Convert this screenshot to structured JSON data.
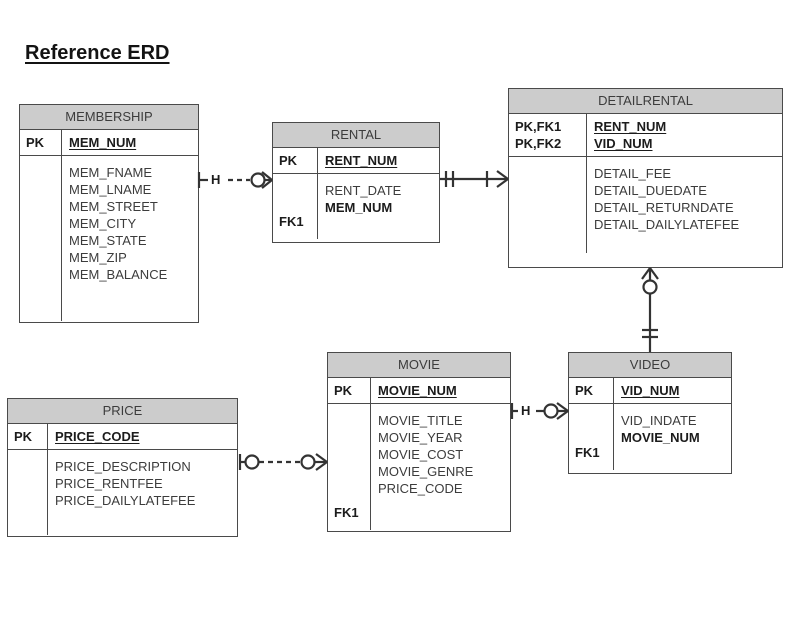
{
  "page": {
    "title": "Reference ERD",
    "background": "#ffffff",
    "line_color": "#333333",
    "header_fill": "#cccccc",
    "border_color": "#4a4a4a"
  },
  "entities": [
    {
      "name": "MEMBERSHIP",
      "keys": [
        "PK"
      ],
      "key_attributes": [
        "MEM_NUM"
      ],
      "attributes": [
        {
          "key": "",
          "name": "MEM_FNAME"
        },
        {
          "key": "",
          "name": "MEM_LNAME"
        },
        {
          "key": "",
          "name": "MEM_STREET"
        },
        {
          "key": "",
          "name": "MEM_CITY"
        },
        {
          "key": "",
          "name": "MEM_STATE"
        },
        {
          "key": "",
          "name": "MEM_ZIP"
        },
        {
          "key": "",
          "name": "MEM_BALANCE"
        }
      ]
    },
    {
      "name": "RENTAL",
      "keys": [
        "PK"
      ],
      "key_attributes": [
        "RENT_NUM"
      ],
      "attributes": [
        {
          "key": "",
          "name": "RENT_DATE"
        },
        {
          "key": "FK1",
          "name": "MEM_NUM",
          "bold": true
        }
      ]
    },
    {
      "name": "DETAILRENTAL",
      "keys": [
        "PK,FK1",
        "PK,FK2"
      ],
      "key_attributes": [
        "RENT_NUM",
        "VID_NUM"
      ],
      "attributes": [
        {
          "key": "",
          "name": "DETAIL_FEE"
        },
        {
          "key": "",
          "name": "DETAIL_DUEDATE"
        },
        {
          "key": "",
          "name": "DETAIL_RETURNDATE"
        },
        {
          "key": "",
          "name": "DETAIL_DAILYLATEFEE"
        }
      ]
    },
    {
      "name": "PRICE",
      "keys": [
        "PK"
      ],
      "key_attributes": [
        "PRICE_CODE"
      ],
      "attributes": [
        {
          "key": "",
          "name": "PRICE_DESCRIPTION"
        },
        {
          "key": "",
          "name": "PRICE_RENTFEE"
        },
        {
          "key": "",
          "name": "PRICE_DAILYLATEFEE"
        }
      ]
    },
    {
      "name": "MOVIE",
      "keys": [
        "PK"
      ],
      "key_attributes": [
        "MOVIE_NUM"
      ],
      "attributes": [
        {
          "key": "",
          "name": "MOVIE_TITLE"
        },
        {
          "key": "",
          "name": "MOVIE_YEAR"
        },
        {
          "key": "",
          "name": "MOVIE_COST"
        },
        {
          "key": "",
          "name": "MOVIE_GENRE"
        },
        {
          "key": "FK1",
          "name": "PRICE_CODE"
        }
      ]
    },
    {
      "name": "VIDEO",
      "keys": [
        "PK"
      ],
      "key_attributes": [
        "VID_NUM"
      ],
      "attributes": [
        {
          "key": "",
          "name": "VID_INDATE"
        },
        {
          "key": "FK1",
          "name": "MOVIE_NUM",
          "bold": true
        }
      ]
    }
  ],
  "relationships": [
    {
      "from": "MEMBERSHIP",
      "to": "RENTAL",
      "line_style": "dashed",
      "from_cardinality": "one-mandatory",
      "to_cardinality": "zero-or-many",
      "label": "H"
    },
    {
      "from": "RENTAL",
      "to": "DETAILRENTAL",
      "line_style": "solid",
      "from_cardinality": "one-and-only-one",
      "to_cardinality": "one-or-many",
      "label": ""
    },
    {
      "from": "DETAILRENTAL",
      "to": "VIDEO",
      "line_style": "solid",
      "from_cardinality": "zero-or-many",
      "to_cardinality": "one-and-only-one",
      "label": ""
    },
    {
      "from": "PRICE",
      "to": "MOVIE",
      "line_style": "dashed",
      "from_cardinality": "zero-or-one",
      "to_cardinality": "zero-or-many",
      "label": ""
    },
    {
      "from": "MOVIE",
      "to": "VIDEO",
      "line_style": "solid",
      "from_cardinality": "one-mandatory",
      "to_cardinality": "zero-or-many",
      "label": "H"
    }
  ]
}
